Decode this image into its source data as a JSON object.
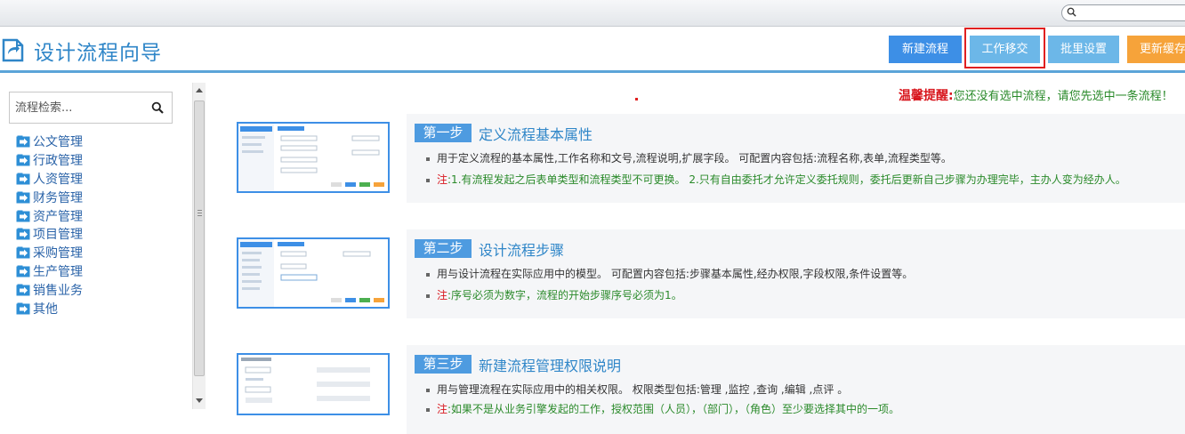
{
  "header": {
    "title": "设计流程向导",
    "buttons": {
      "new_flow": "新建流程",
      "work_transfer": "工作移交",
      "batch_settings": "批里设置",
      "update_cache": "更新缓存"
    }
  },
  "sidebar": {
    "search_placeholder": "流程检索...",
    "items": [
      "公文管理",
      "行政管理",
      "人资管理",
      "财务管理",
      "资产管理",
      "项目管理",
      "采购管理",
      "生产管理",
      "销售业务",
      "其他"
    ]
  },
  "notice": {
    "label": "温馨提醒:",
    "text": "您还没有选中流程，请您先选中一条流程！"
  },
  "steps": [
    {
      "badge": "第一步",
      "title": "定义流程基本属性",
      "desc": "用于定义流程的基本属性,工作名称和文号,流程说明,扩展字段。 可配置内容包括:流程名称,表单,流程类型等。",
      "note_key": "注",
      "note": ":1.有流程发起之后表单类型和流程类型不可更换。 2.只有自由委托才允许定义委托规则，委托后更新自己步骤为办理完毕，主办人变为经办人。"
    },
    {
      "badge": "第二步",
      "title": "设计流程步骤",
      "desc": "用与设计流程在实际应用中的模型。 可配置内容包括:步骤基本属性,经办权限,字段权限,条件设置等。",
      "note_key": "注",
      "note": ":序号必须为数字，流程的开始步骤序号必须为1。"
    },
    {
      "badge": "第三步",
      "title": "新建流程管理权限说明",
      "desc": "用与管理流程在实际应用中的相关权限。 权限类型包括:管理 ,监控 ,查询 ,编辑 ,点评 。",
      "note_key": "注",
      "note": ":如果不是从业务引擎发起的工作，授权范围（人员），（部门），（角色）至少要选择其中的一项。"
    }
  ],
  "colors": {
    "accent": "#2f86c8",
    "button_primary": "#3d8fe6",
    "button_secondary": "#6cb7e8",
    "button_warning": "#f6a33a",
    "notice_red": "#d8161d",
    "note_green": "#2a8a2a"
  }
}
